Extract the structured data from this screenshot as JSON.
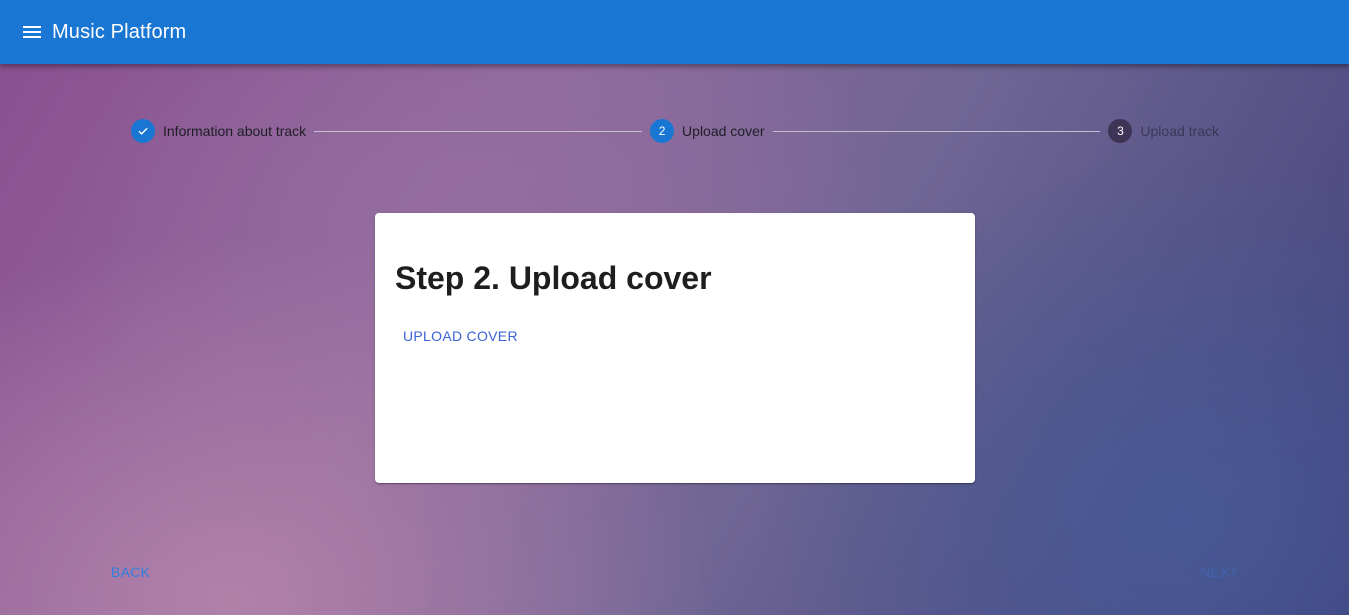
{
  "app": {
    "title": "Music Platform",
    "menu_icon": "menu-icon",
    "bar_color": "#1976d2"
  },
  "stepper": {
    "steps": [
      {
        "number": "",
        "label": "Information about track",
        "state": "completed",
        "icon": "check-circle-icon"
      },
      {
        "number": "2",
        "label": "Upload cover",
        "state": "active"
      },
      {
        "number": "3",
        "label": "Upload track",
        "state": "inactive"
      }
    ],
    "active_index": 1
  },
  "card": {
    "title": "Step 2. Upload cover",
    "upload_button": "UPLOAD COVER"
  },
  "navigation": {
    "back_label": "BACK",
    "next_label": "NEXT",
    "next_disabled": true
  },
  "colors": {
    "primary": "#1976d2",
    "link": "#3b63d8"
  }
}
